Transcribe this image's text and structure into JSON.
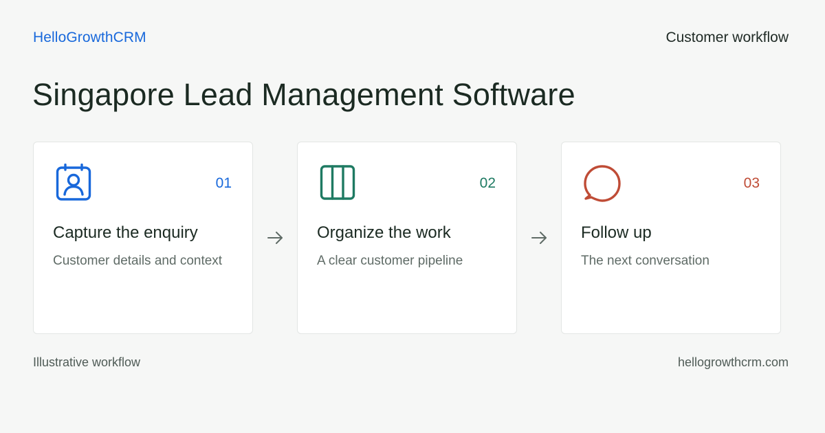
{
  "header": {
    "brand": "HelloGrowthCRM",
    "section_label": "Customer workflow",
    "title": "Singapore Lead Management Software"
  },
  "steps": [
    {
      "number": "01",
      "title": "Capture the enquiry",
      "description": "Customer details and context",
      "icon": "contact-card-icon",
      "color": "#1868db"
    },
    {
      "number": "02",
      "title": "Organize the work",
      "description": "A clear customer pipeline",
      "icon": "kanban-columns-icon",
      "color": "#1e7a62"
    },
    {
      "number": "03",
      "title": "Follow up",
      "description": "The next conversation",
      "icon": "chat-bubble-icon",
      "color": "#bf4c36"
    }
  ],
  "footer": {
    "note": "Illustrative workflow",
    "domain": "hellogrowthcrm.com"
  }
}
